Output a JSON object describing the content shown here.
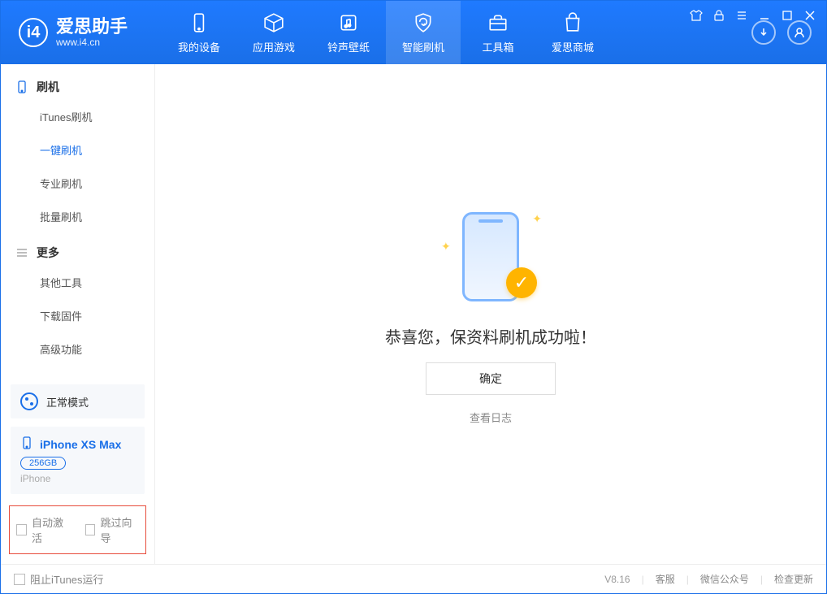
{
  "app": {
    "name": "爱思助手",
    "url": "www.i4.cn"
  },
  "tabs": [
    {
      "label": "我的设备"
    },
    {
      "label": "应用游戏"
    },
    {
      "label": "铃声壁纸"
    },
    {
      "label": "智能刷机"
    },
    {
      "label": "工具箱"
    },
    {
      "label": "爱思商城"
    }
  ],
  "sidebar": {
    "group1_title": "刷机",
    "items1": [
      {
        "label": "iTunes刷机"
      },
      {
        "label": "一键刷机"
      },
      {
        "label": "专业刷机"
      },
      {
        "label": "批量刷机"
      }
    ],
    "group2_title": "更多",
    "items2": [
      {
        "label": "其他工具"
      },
      {
        "label": "下载固件"
      },
      {
        "label": "高级功能"
      }
    ],
    "mode_label": "正常模式",
    "device": {
      "name": "iPhone XS Max",
      "storage": "256GB",
      "type": "iPhone"
    },
    "checkbox1": "自动激活",
    "checkbox2": "跳过向导"
  },
  "main": {
    "message": "恭喜您，保资料刷机成功啦！",
    "ok_label": "确定",
    "log_link": "查看日志"
  },
  "status": {
    "block_itunes": "阻止iTunes运行",
    "version": "V8.16",
    "service": "客服",
    "wechat": "微信公众号",
    "update": "检查更新"
  }
}
